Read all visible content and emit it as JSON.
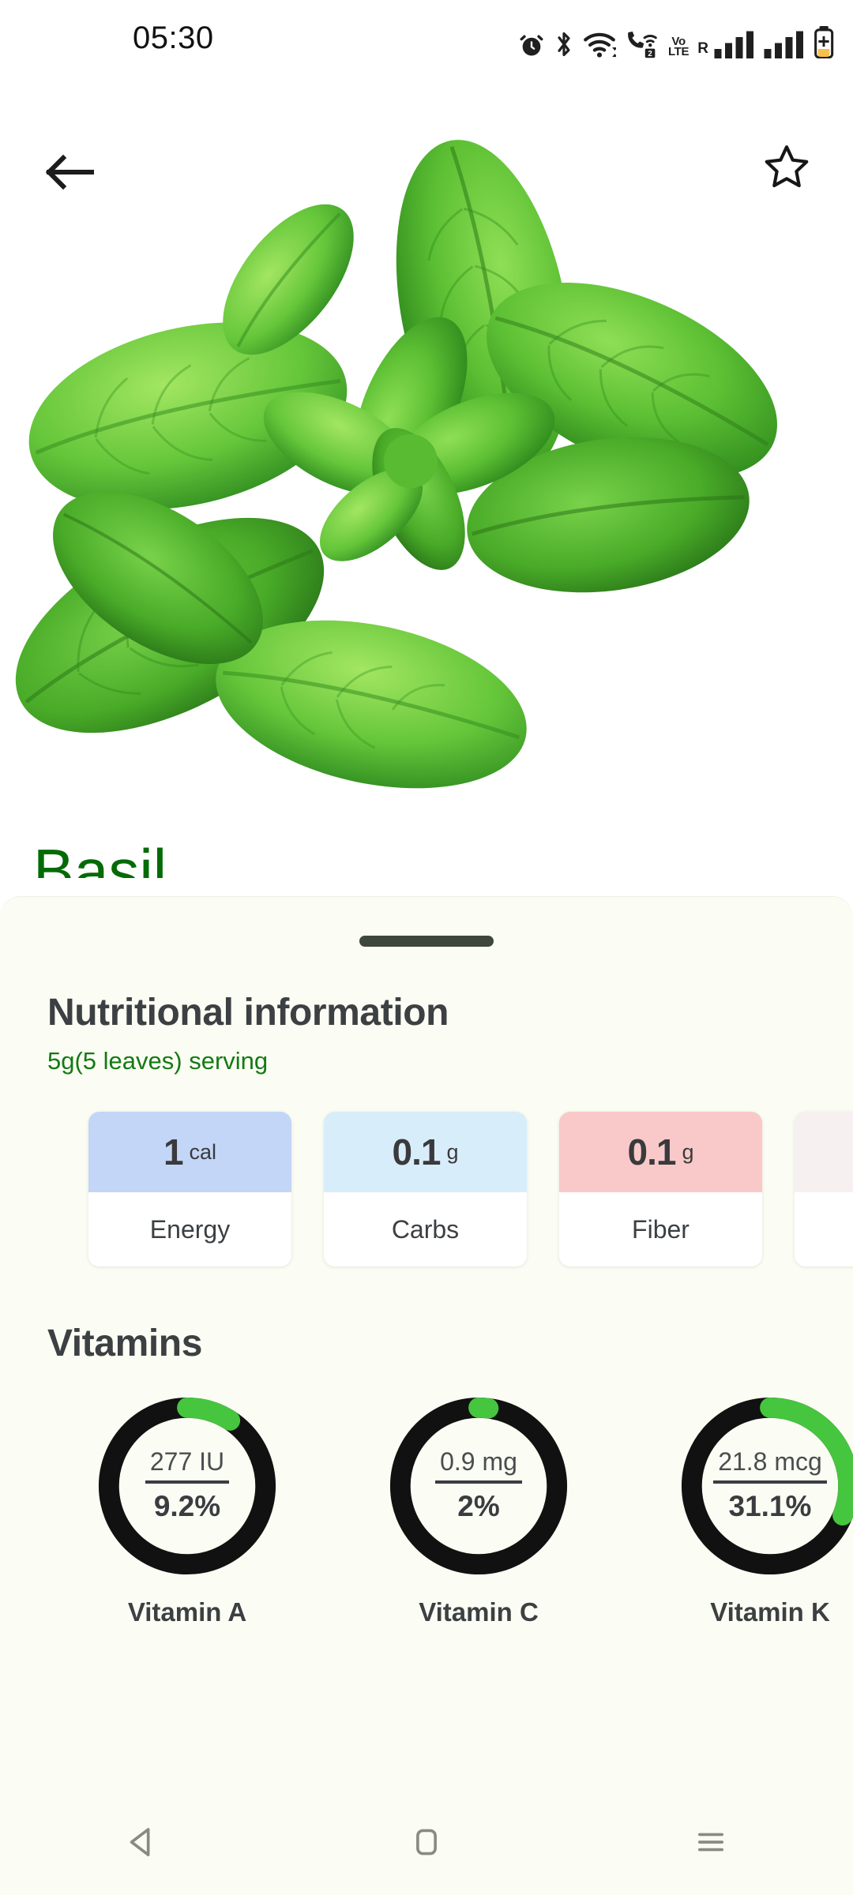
{
  "status_bar": {
    "time": "05:30",
    "icons": [
      "alarm-icon",
      "bluetooth-icon",
      "wifi-icon",
      "wifi-calling-sim2-icon",
      "volte-icon",
      "roaming-signal-icon",
      "signal-icon",
      "battery-charging-icon"
    ],
    "volte_top": "Vo",
    "volte_bottom": "LTE",
    "sim_badge": "2",
    "roaming_label": "R"
  },
  "header": {
    "back_icon": "back-arrow-icon",
    "favorite_icon": "star-outline-icon",
    "title": "Basil",
    "title_color": "#046a06"
  },
  "sheet": {
    "section_title": "Nutritional information",
    "serving": "5g(5 leaves) serving",
    "vitamins_title": "Vitamins"
  },
  "nutrients": [
    {
      "value": "1",
      "unit": "cal",
      "label": "Energy",
      "color": "#c3d6f7"
    },
    {
      "value": "0.1",
      "unit": "g",
      "label": "Carbs",
      "color": "#d8edfa"
    },
    {
      "value": "0.1",
      "unit": "g",
      "label": "Fiber",
      "color": "#f9c9c9"
    },
    {
      "value": "",
      "unit": "",
      "label": "",
      "color": "#f6f0f0"
    }
  ],
  "vitamins": [
    {
      "name": "Vitamin A",
      "amount": "277 IU",
      "percent": "9.2%",
      "value": 9.2
    },
    {
      "name": "Vitamin C",
      "amount": "0.9 mg",
      "percent": "2%",
      "value": 2
    },
    {
      "name": "Vitamin K",
      "amount": "21.8 mcg",
      "percent": "31.1%",
      "value": 31.1
    }
  ],
  "ring_colors": {
    "track": "#111111",
    "progress": "#46c53f"
  },
  "nav_bar": {
    "back": "nav-back-icon",
    "home": "nav-home-icon",
    "recents": "nav-recents-icon"
  }
}
